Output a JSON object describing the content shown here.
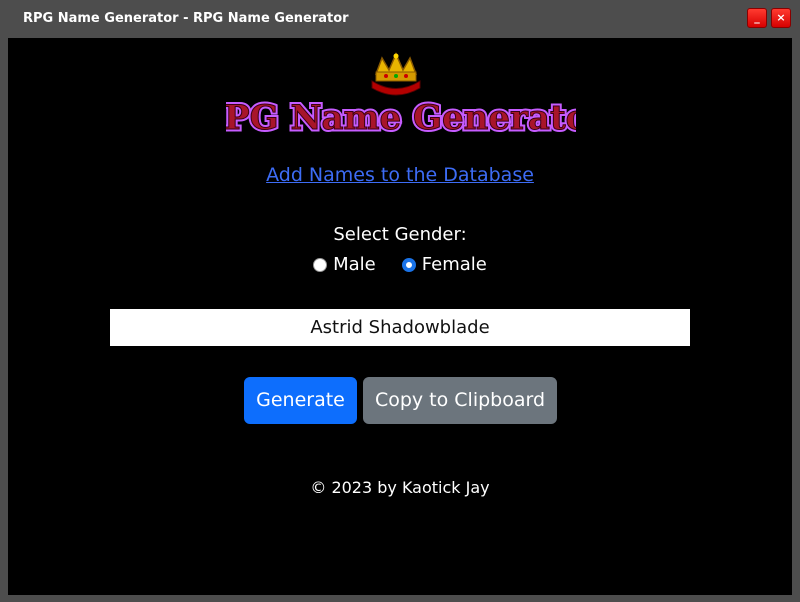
{
  "window": {
    "title": "RPG Name Generator - RPG Name Generator",
    "minimize_label": "_",
    "close_label": "×"
  },
  "header": {
    "logo_text": "RPG Name Generator",
    "logo_icon": "crown-icon"
  },
  "links": {
    "add_names": "Add Names to the Database"
  },
  "gender": {
    "label": "Select Gender:",
    "options": [
      {
        "label": "Male",
        "checked": false
      },
      {
        "label": "Female",
        "checked": true
      }
    ]
  },
  "result": {
    "name": "Astrid Shadowblade"
  },
  "buttons": {
    "generate": "Generate",
    "copy": "Copy to Clipboard"
  },
  "footer": {
    "copyright": "© 2023 by Kaotick Jay"
  },
  "colors": {
    "link": "#3d6cf5",
    "generate_button": "#0d6efd",
    "copy_button": "#6c757d",
    "radio_checked": "#1a73e8"
  }
}
